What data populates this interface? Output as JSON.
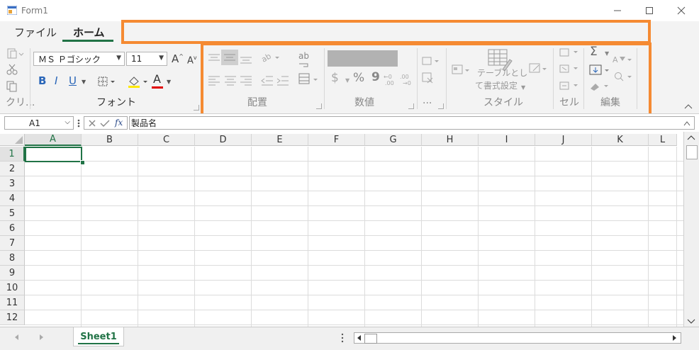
{
  "window": {
    "title": "Form1"
  },
  "ribbon": {
    "tabs": [
      {
        "label": "ファイル"
      },
      {
        "label": "ホーム"
      }
    ],
    "font": {
      "name": "ＭＳ Ｐゴシック",
      "size": "11",
      "group_label": "フォント"
    },
    "groups": {
      "clipboard": "クリ...",
      "alignment": "配置",
      "number": "数値",
      "number_ellipsis": "...",
      "styles": "スタイル",
      "table_format_line1": "テーブルとし",
      "table_format_line2": "て書式設定",
      "cells": "セル",
      "editing": "編集"
    },
    "icons": {
      "bold": "B",
      "italic": "I",
      "underline": "U",
      "font_color": "A",
      "currency": "$",
      "percent": "%",
      "comma": "9",
      "wrap": "ab",
      "increase_decimal": "←0\n.00",
      "decrease_decimal": ".00\n→0"
    }
  },
  "formula_bar": {
    "name_box": "A1",
    "fx_label": "fx",
    "value": "製品名"
  },
  "grid": {
    "columns": [
      "A",
      "B",
      "C",
      "D",
      "E",
      "F",
      "G",
      "H",
      "I",
      "J",
      "K",
      "L"
    ],
    "rows": [
      "1",
      "2",
      "3",
      "4",
      "5",
      "6",
      "7",
      "8",
      "9",
      "10",
      "11",
      "12"
    ],
    "selected_cell": "A1"
  },
  "sheets": [
    {
      "name": "Sheet1"
    }
  ],
  "colors": {
    "accent": "#217346",
    "highlight_box": "#f58a32"
  }
}
